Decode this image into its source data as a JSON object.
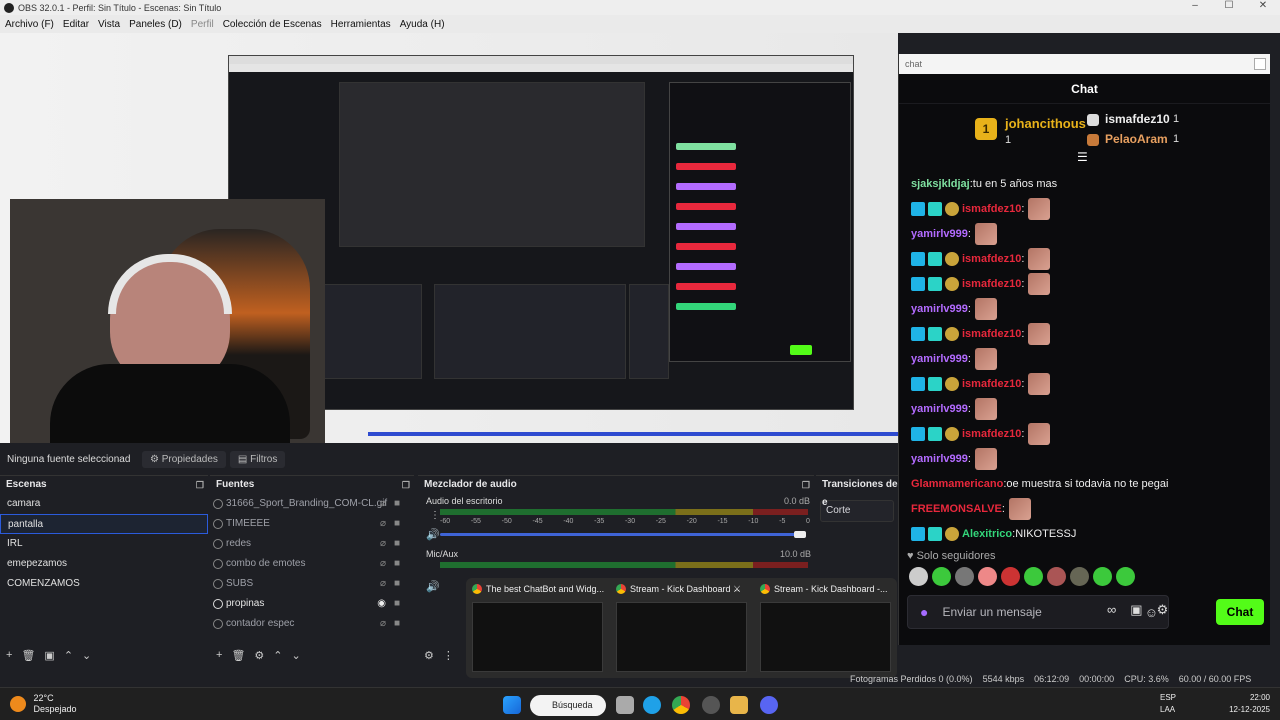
{
  "window": {
    "title": "OBS 32.0.1 - Perfil: Sin Título - Escenas: Sin Título"
  },
  "menu": {
    "items": [
      "Archivo (F)",
      "Editar",
      "Vista",
      "Paneles (D)",
      "Perfil",
      "Colección de Escenas",
      "Herramientas",
      "Ayuda (H)"
    ]
  },
  "source_bar": {
    "no_source": "Ninguna fuente seleccionad",
    "properties": "Propiedades",
    "filters": "Filtros"
  },
  "scenes": {
    "title": "Escenas",
    "items": [
      "camara",
      "pantalla",
      "IRL",
      "emepezamos",
      "COMENZAMOS"
    ],
    "selected": "pantalla"
  },
  "sources": {
    "title": "Fuentes",
    "items": [
      "31666_Sport_Branding_COM-CL.gif",
      "TIMEEEE",
      "redes",
      "combo de emotes",
      "SUBS",
      "propinas",
      "contador espec"
    ]
  },
  "mixer": {
    "title": "Mezclador de audio",
    "channels": [
      {
        "name": "Audio del escritorio",
        "db": "0.0 dB"
      },
      {
        "name": "Mic/Aux",
        "db": "10.0 dB"
      }
    ],
    "ticks": [
      "-60",
      "-55",
      "-50",
      "-45",
      "-40",
      "-35",
      "-30",
      "-25",
      "-20",
      "-15",
      "-10",
      "-5",
      "0"
    ]
  },
  "transitions": {
    "title": "Transiciones de e",
    "value": "Corte"
  },
  "chat": {
    "window_label": "chat",
    "header": "Chat",
    "podium": [
      {
        "rank": "1",
        "name": "johancithous",
        "count": "1"
      },
      {
        "name": "ismafdez10",
        "count": "1"
      },
      {
        "name": "PelaoAram",
        "count": "1"
      }
    ],
    "messages": [
      {
        "user": "sjaksjkldjaj",
        "color": "#7fe0a0",
        "text": "tu en 5 años mas",
        "badges": false,
        "emote": false
      },
      {
        "user": "ismafdez10",
        "color": "#e8283c",
        "text": "",
        "badges": true,
        "emote": true
      },
      {
        "user": "yamirlv999",
        "color": "#b36bff",
        "text": "",
        "badges": false,
        "emote": true
      },
      {
        "user": "ismafdez10",
        "color": "#e8283c",
        "text": "",
        "badges": true,
        "emote": true
      },
      {
        "user": "ismafdez10",
        "color": "#e8283c",
        "text": "",
        "badges": true,
        "emote": true
      },
      {
        "user": "yamirlv999",
        "color": "#b36bff",
        "text": "",
        "badges": false,
        "emote": true
      },
      {
        "user": "ismafdez10",
        "color": "#e8283c",
        "text": "",
        "badges": true,
        "emote": true
      },
      {
        "user": "yamirlv999",
        "color": "#b36bff",
        "text": "",
        "badges": false,
        "emote": true
      },
      {
        "user": "ismafdez10",
        "color": "#e8283c",
        "text": "",
        "badges": true,
        "emote": true
      },
      {
        "user": "yamirlv999",
        "color": "#b36bff",
        "text": "",
        "badges": false,
        "emote": true
      },
      {
        "user": "ismafdez10",
        "color": "#e8283c",
        "text": "",
        "badges": true,
        "emote": true
      },
      {
        "user": "yamirlv999",
        "color": "#b36bff",
        "text": "",
        "badges": false,
        "emote": true
      },
      {
        "user": "Glammamericano",
        "color": "#e8283c",
        "text": "oe muestra si todavia no te pegai",
        "badges": false,
        "emote": false
      },
      {
        "user": "FREEMONSALVE",
        "color": "#e8283c",
        "text": "",
        "badges": false,
        "emote": true
      },
      {
        "user": "Alexitrico",
        "color": "#33d67a",
        "text": "NIKOTESSJ",
        "badges": true,
        "emote": false
      }
    ],
    "followers_only": "Solo seguidores",
    "input_placeholder": "Enviar un mensaje",
    "send_label": "Chat"
  },
  "taskbar_previews": [
    {
      "title": "The best ChatBot and Widg..."
    },
    {
      "title": "Stream - Kick Dashboard ⚔"
    },
    {
      "title": "Stream - Kick Dashboard -..."
    }
  ],
  "status": {
    "dropped": "Fotogramas Perdidos 0 (0.0%)",
    "bitrate": "5544 kbps",
    "live_time": "06:12:09",
    "rec_time": "00:00:00",
    "cpu": "CPU: 3.6%",
    "fps": "60.00 / 60.00 FPS"
  },
  "taskbar": {
    "temp": "22°C",
    "weather": "Despejado",
    "search": "Búsqueda",
    "lang": "ESP",
    "lang2": "LAA",
    "time": "22:00",
    "date": "12-12-2025"
  },
  "colors": {
    "accent": "#53fc18",
    "selection": "#2b5bdc",
    "obs_bg": "#1e1f24"
  }
}
